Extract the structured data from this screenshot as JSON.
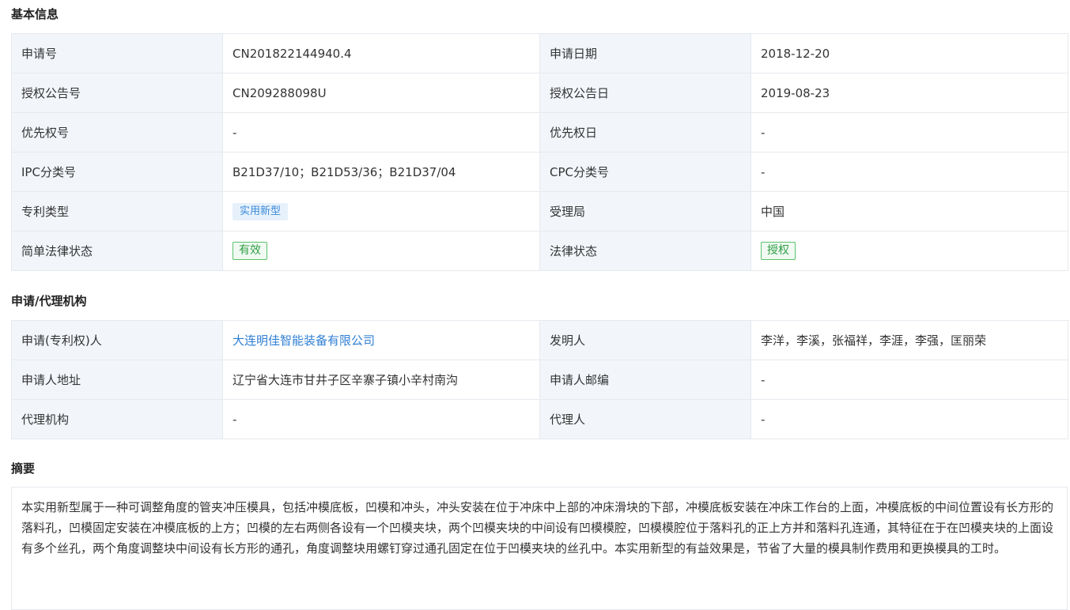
{
  "basic": {
    "title": "基本信息",
    "rows": [
      {
        "l1": "申请号",
        "v1": "CN201822144940.4",
        "l2": "申请日期",
        "v2": "2018-12-20"
      },
      {
        "l1": "授权公告号",
        "v1": "CN209288098U",
        "l2": "授权公告日",
        "v2": "2019-08-23"
      },
      {
        "l1": "优先权号",
        "v1": "-",
        "l2": "优先权日",
        "v2": "-"
      },
      {
        "l1": "IPC分类号",
        "v1": "B21D37/10；B21D53/36；B21D37/04",
        "l2": "CPC分类号",
        "v2": "-"
      },
      {
        "l1": "专利类型",
        "v1": "实用新型",
        "l2": "受理局",
        "v2": "中国"
      },
      {
        "l1": "简单法律状态",
        "v1": "有效",
        "l2": "法律状态",
        "v2": "授权"
      }
    ]
  },
  "agency": {
    "title": "申请/代理机构",
    "rows": [
      {
        "l1": "申请(专利权)人",
        "v1": "大连明佳智能装备有限公司",
        "l2": "发明人",
        "v2": "李洋，李溪，张福祥，李涯，李强，匡丽荣"
      },
      {
        "l1": "申请人地址",
        "v1": "辽宁省大连市甘井子区辛寨子镇小辛村南沟",
        "l2": "申请人邮编",
        "v2": "-"
      },
      {
        "l1": "代理机构",
        "v1": "-",
        "l2": "代理人",
        "v2": "-"
      }
    ]
  },
  "abstract": {
    "title": "摘要",
    "text": "本实用新型属于一种可调整角度的管夹冲压模具，包括冲模底板，凹模和冲头，冲头安装在位于冲床中上部的冲床滑块的下部，冲模底板安装在冲床工作台的上面，冲模底板的中间位置设有长方形的落料孔，凹模固定安装在冲模底板的上方；凹模的左右两侧各设有一个凹模夹块，两个凹模夹块的中间设有凹模模腔，凹模模腔位于落料孔的正上方并和落料孔连通，其特征在于在凹模夹块的上面设有多个丝孔，两个角度调整块中间设有长方形的通孔，角度调整块用螺钉穿过通孔固定在位于凹模夹块的丝孔中。本实用新型的有益效果是，节省了大量的模具制作费用和更换模具的工时。"
  }
}
